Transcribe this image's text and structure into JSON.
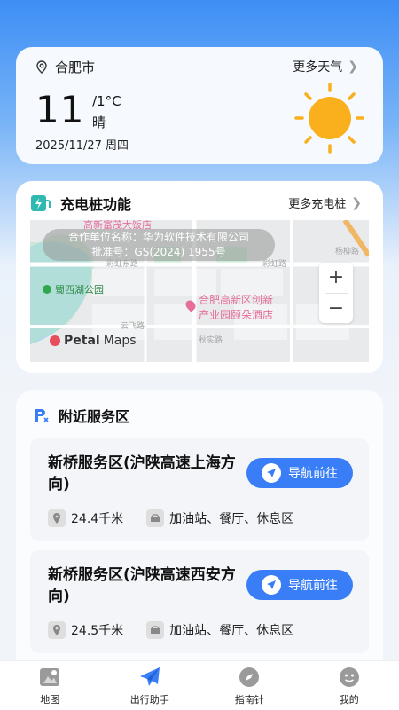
{
  "weather": {
    "city": "合肥市",
    "more_label": "更多天气",
    "temp": "11",
    "low_temp": "/1°C",
    "condition": "晴",
    "date": "2025/11/27 周四"
  },
  "charging": {
    "title": "充电桩功能",
    "more_label": "更多充电桩",
    "map": {
      "watermark_line1": "合作单位名称：华为软件技术有限公司",
      "watermark_line2": "批准号：GS(2024) 1955号",
      "poi_top": "高新富茂大饭店",
      "park": "蜀西湖公园",
      "hotel_line1": "合肥高新区创新",
      "hotel_line2": "产业园颐朵酒店",
      "road_caihong_east": "彩虹东路",
      "road_caihong": "彩虹路",
      "road_yunfei": "云飞路",
      "road_qiushi": "秋实路",
      "road_yangliu": "杨柳路",
      "zoom_in": "+",
      "zoom_out": "−",
      "brand_a": "Petal",
      "brand_b": " Maps"
    }
  },
  "service": {
    "title": "附近服务区",
    "items": [
      {
        "name": "新桥服务区(沪陕高速上海方向)",
        "nav_label": "导航前往",
        "distance": "24.4千米",
        "facilities": "加油站、餐厅、休息区"
      },
      {
        "name": "新桥服务区(沪陕高速西安方向)",
        "nav_label": "导航前往",
        "distance": "24.5千米",
        "facilities": "加油站、餐厅、休息区"
      }
    ]
  },
  "bottom_nav": [
    {
      "label": "地图"
    },
    {
      "label": "出行助手"
    },
    {
      "label": "指南针"
    },
    {
      "label": "我的"
    }
  ],
  "colors": {
    "accent": "#3a7ef7",
    "sun": "#f9b01c"
  }
}
